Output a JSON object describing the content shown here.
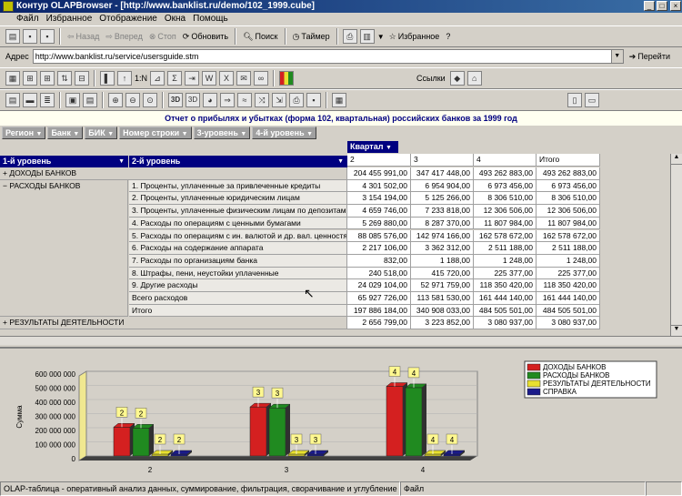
{
  "window": {
    "title": "Контур OLAPBrowser - [http://www.banklist.ru/demo/102_1999.cube]"
  },
  "menu": [
    "Файл",
    "Избранное",
    "Отображение",
    "Окна",
    "Помощь"
  ],
  "toolbar": {
    "back": "Назад",
    "forward": "Вперед",
    "stop": "Стоп",
    "refresh": "Обновить",
    "search": "Поиск",
    "timer": "Таймер",
    "favorites": "Избранное"
  },
  "address": {
    "label": "Адрес",
    "value": "http://www.banklist.ru/service/usersguide.stm",
    "go": "Перейти"
  },
  "toolbar3": {
    "links": "Ссылки",
    "topn": "1:N"
  },
  "report": {
    "title": "Отчет о прибылях и убытках (форма 102, квартальная) российских банков за 1999 год"
  },
  "dimensions": [
    "Регион",
    "Банк",
    "БИК",
    "Номер строки",
    "3-уровень",
    "4-й уровень"
  ],
  "pivot": {
    "col_dim": "Квартал",
    "row_dim1": "1-й уровень",
    "row_dim2": "2-й уровень",
    "col_headers": [
      "2",
      "3",
      "4",
      "Итого"
    ],
    "rows": [
      {
        "l1": "ДОХОДЫ БАНКОВ",
        "l2": "",
        "values": [
          "204 455 991,00",
          "347 417 448,00",
          "493 262 883,00",
          "493 262 883,00"
        ]
      },
      {
        "l1": "РАСХОДЫ БАНКОВ",
        "l2": "1. Проценты, уплаченные за привлеченные кредиты",
        "values": [
          "4 301 502,00",
          "6 954 904,00",
          "6 973 456,00",
          "6 973 456,00"
        ]
      },
      {
        "l1": "",
        "l2": "2. Проценты, уплаченные юридическим лицам",
        "values": [
          "3 154 194,00",
          "5 125 266,00",
          "8 306 510,00",
          "8 306 510,00"
        ]
      },
      {
        "l1": "",
        "l2": "3. Проценты, уплаченные физическим лицам по депозитам",
        "values": [
          "4 659 746,00",
          "7 233 818,00",
          "12 306 506,00",
          "12 306 506,00"
        ]
      },
      {
        "l1": "",
        "l2": "4. Расходы по операциям с ценными бумагами",
        "values": [
          "5 269 880,00",
          "8 287 370,00",
          "11 807 984,00",
          "11 807 984,00"
        ]
      },
      {
        "l1": "",
        "l2": "5. Расходы по операциям с ин. валютой и др. вал. ценностями",
        "values": [
          "88 085 576,00",
          "142 974 166,00",
          "162 578 672,00",
          "162 578 672,00"
        ]
      },
      {
        "l1": "",
        "l2": "6. Расходы на содержание аппарата",
        "values": [
          "2 217 106,00",
          "3 362 312,00",
          "2 511 188,00",
          "2 511 188,00"
        ]
      },
      {
        "l1": "",
        "l2": "7. Расходы по организациям банка",
        "values": [
          "832,00",
          "1 188,00",
          "1 248,00",
          "1 248,00"
        ]
      },
      {
        "l1": "",
        "l2": "8. Штрафы, пени, неустойки уплаченные",
        "values": [
          "240 518,00",
          "415 720,00",
          "225 377,00",
          "225 377,00"
        ]
      },
      {
        "l1": "",
        "l2": "9. Другие расходы",
        "values": [
          "24 029 104,00",
          "52 971 759,00",
          "118 350 420,00",
          "118 350 420,00"
        ]
      },
      {
        "l1": "",
        "l2": "Всего расходов",
        "values": [
          "65 927 726,00",
          "113 581 530,00",
          "161 444 140,00",
          "161 444 140,00"
        ]
      },
      {
        "l1": "",
        "l2": "Итого",
        "values": [
          "197 886 184,00",
          "340 908 033,00",
          "484 505 501,00",
          "484 505 501,00"
        ]
      },
      {
        "l1": "РЕЗУЛЬТАТЫ ДЕЯТЕЛЬНОСТИ",
        "l2": "",
        "values": [
          "2 656 799,00",
          "3 223 852,00",
          "3 080 937,00",
          "3 080 937,00"
        ]
      }
    ]
  },
  "chart_data": {
    "type": "bar",
    "categories": [
      "2",
      "3",
      "4"
    ],
    "ylabel": "Сумма",
    "ylim": [
      0,
      600000000
    ],
    "yticks": [
      "600 000 000",
      "500 000 000",
      "400 000 000",
      "300 000 000",
      "200 000 000",
      "100 000 000",
      "0"
    ],
    "series": [
      {
        "name": "ДОХОДЫ БАНКОВ",
        "color": "#d42020",
        "values": [
          204455991,
          347417448,
          493262883
        ],
        "labels": [
          "2",
          "3",
          "4"
        ]
      },
      {
        "name": "РАСХОДЫ БАНКОВ",
        "color": "#208a20",
        "values": [
          197886184,
          340908033,
          484505501
        ],
        "labels": [
          "2",
          "3",
          "4"
        ]
      },
      {
        "name": "РЕЗУЛЬТАТЫ ДЕЯТЕЛЬНОСТИ",
        "color": "#e8e030",
        "values": [
          2656799,
          3223852,
          3080937
        ],
        "labels": [
          "2",
          "3",
          "4"
        ]
      },
      {
        "name": "СПРАВКА",
        "color": "#1a1a8a",
        "values": [
          0,
          0,
          0
        ],
        "labels": [
          "2",
          "3",
          "4"
        ]
      }
    ]
  },
  "status": {
    "text": "OLAP-таблица - оперативный анализ данных,  суммирование, фильтрация, сворачивание и углубление в данные",
    "mode": "Файл"
  }
}
